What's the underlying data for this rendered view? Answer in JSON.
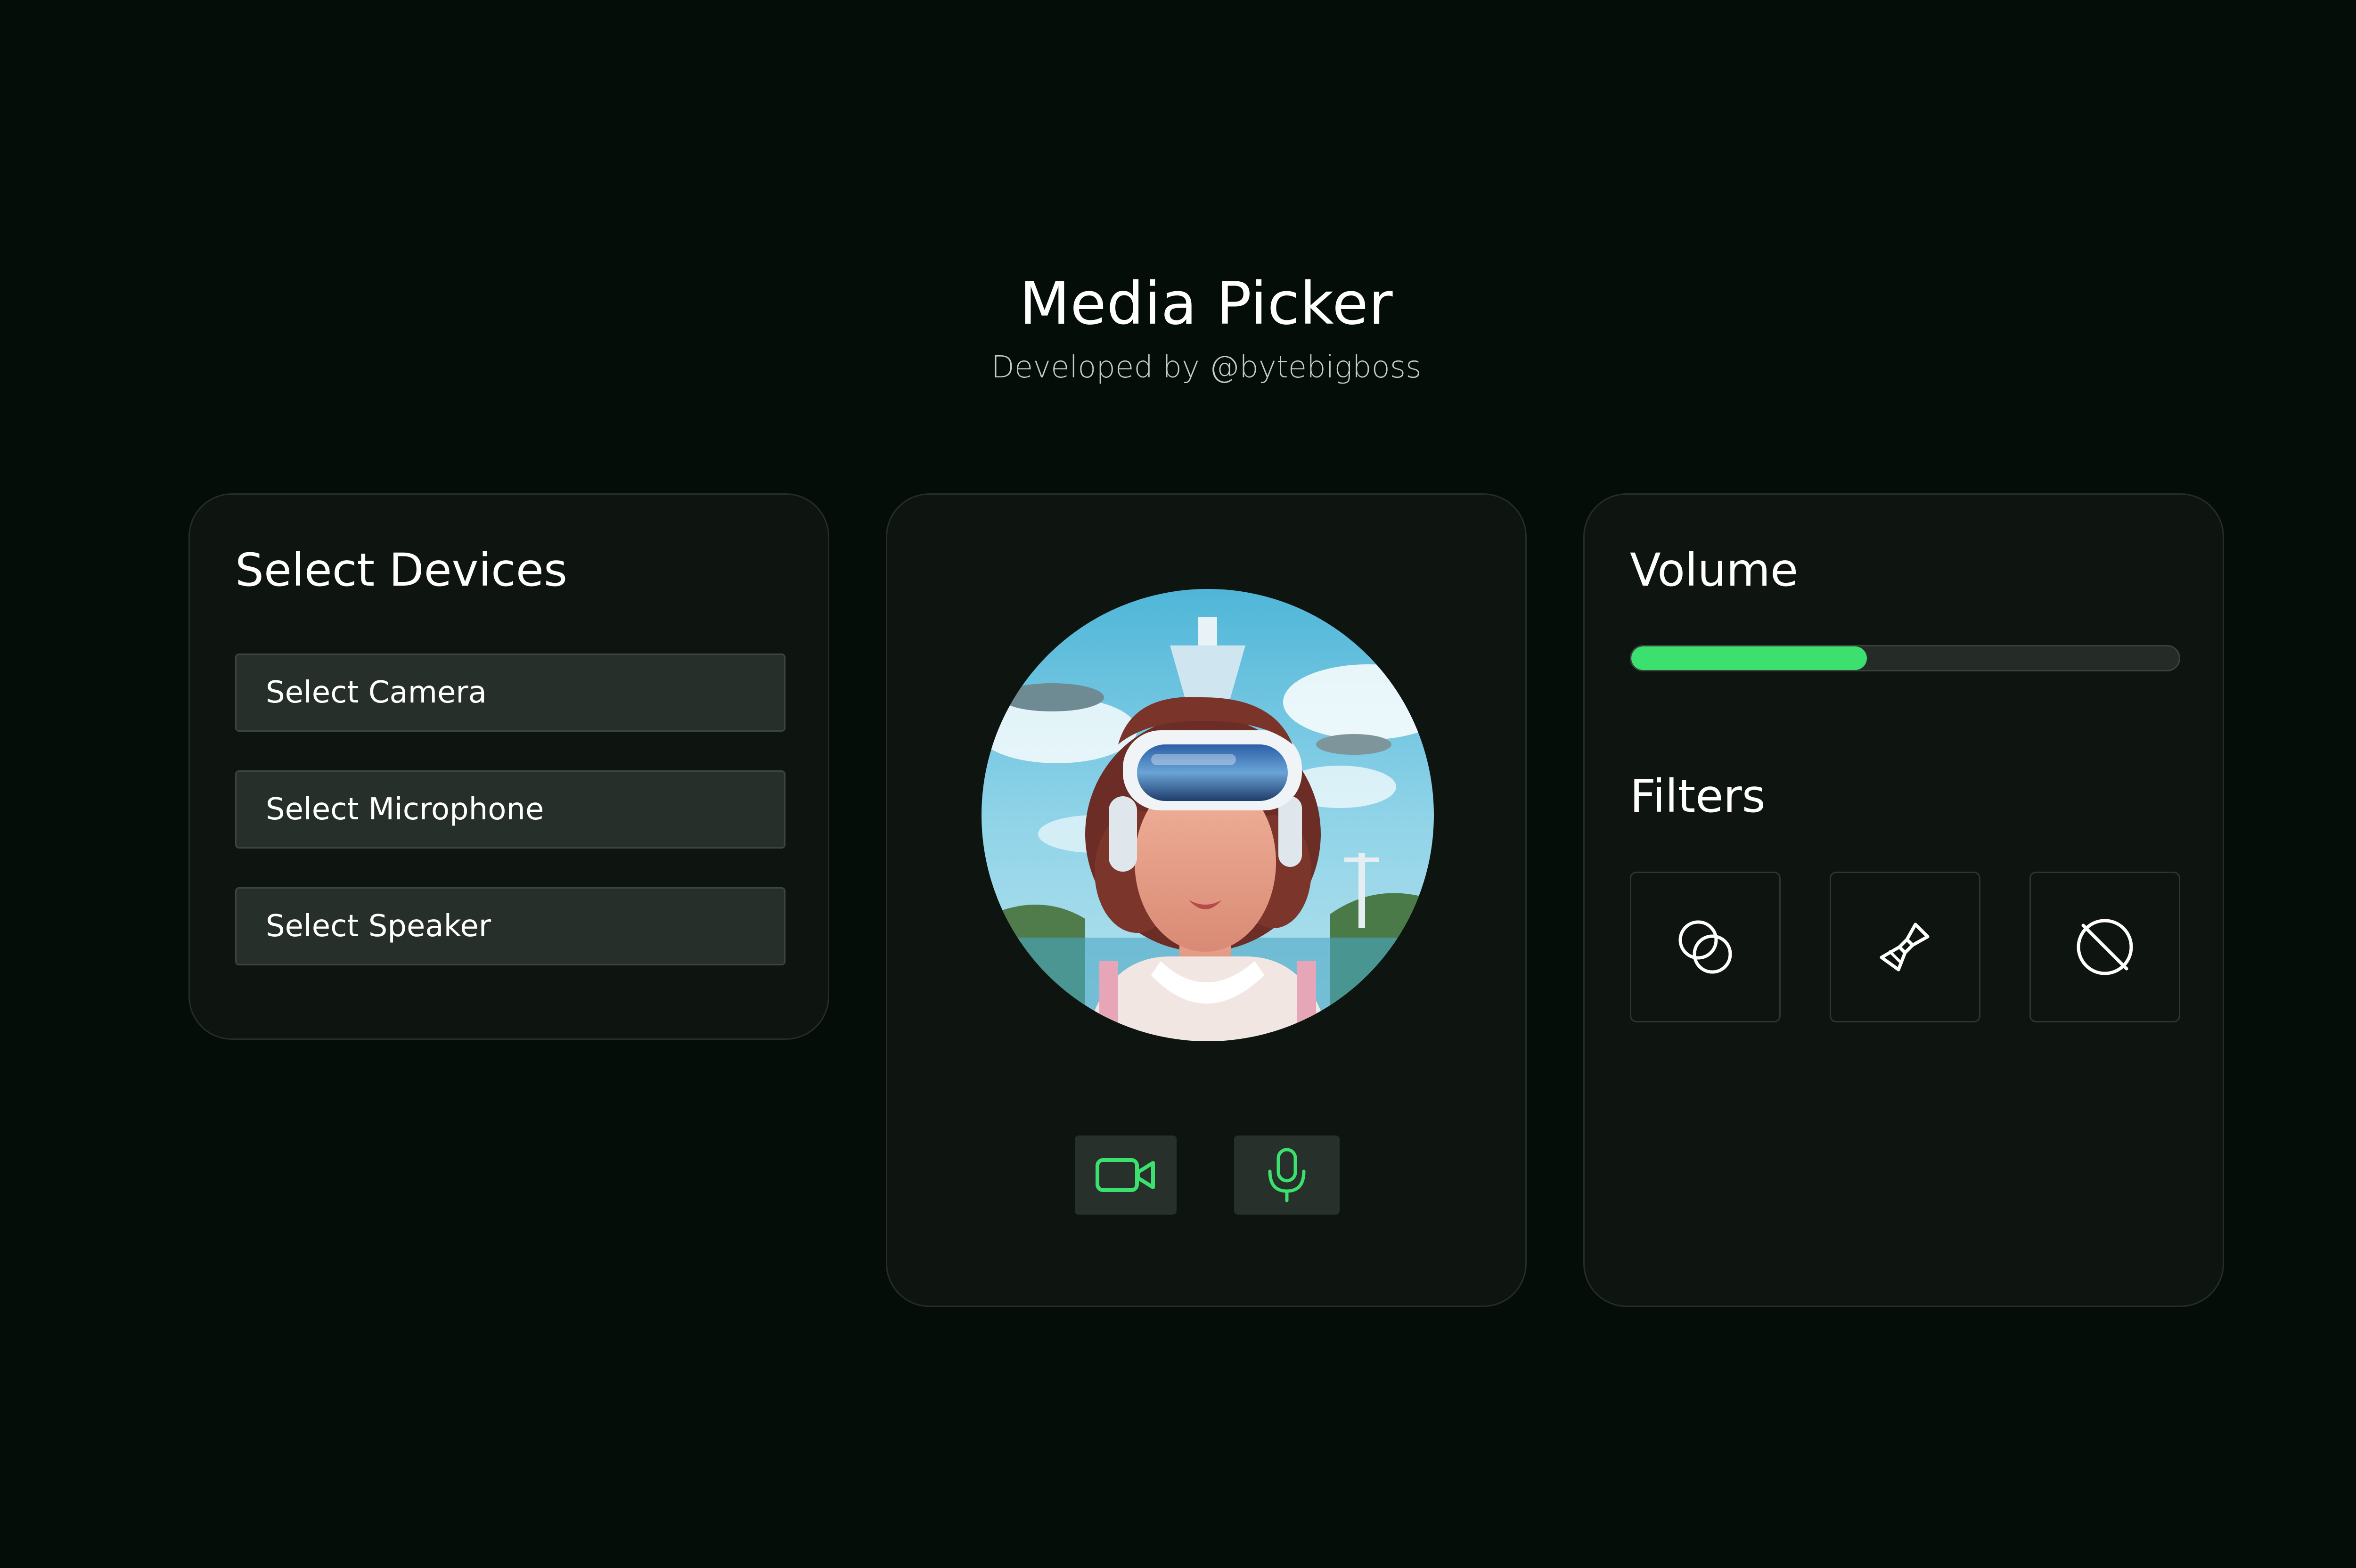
{
  "header": {
    "title": "Media Picker",
    "subtitle": "Developed by @bytebigboss"
  },
  "devices": {
    "heading": "Select Devices",
    "camera_label": "Select Camera",
    "microphone_label": "Select Microphone",
    "speaker_label": "Select Speaker"
  },
  "preview": {
    "avatar_icon": "vr-headset-woman-avatar",
    "camera_button_icon": "video-camera-icon",
    "mic_button_icon": "microphone-icon",
    "accent_color": "#3be06e"
  },
  "volume": {
    "heading": "Volume",
    "level_percent": 43,
    "fill_color": "#3be06e"
  },
  "filters": {
    "heading": "Filters",
    "items": [
      {
        "icon": "blend-circles-icon"
      },
      {
        "icon": "paint-brush-icon"
      },
      {
        "icon": "no-filter-icon"
      }
    ]
  }
}
